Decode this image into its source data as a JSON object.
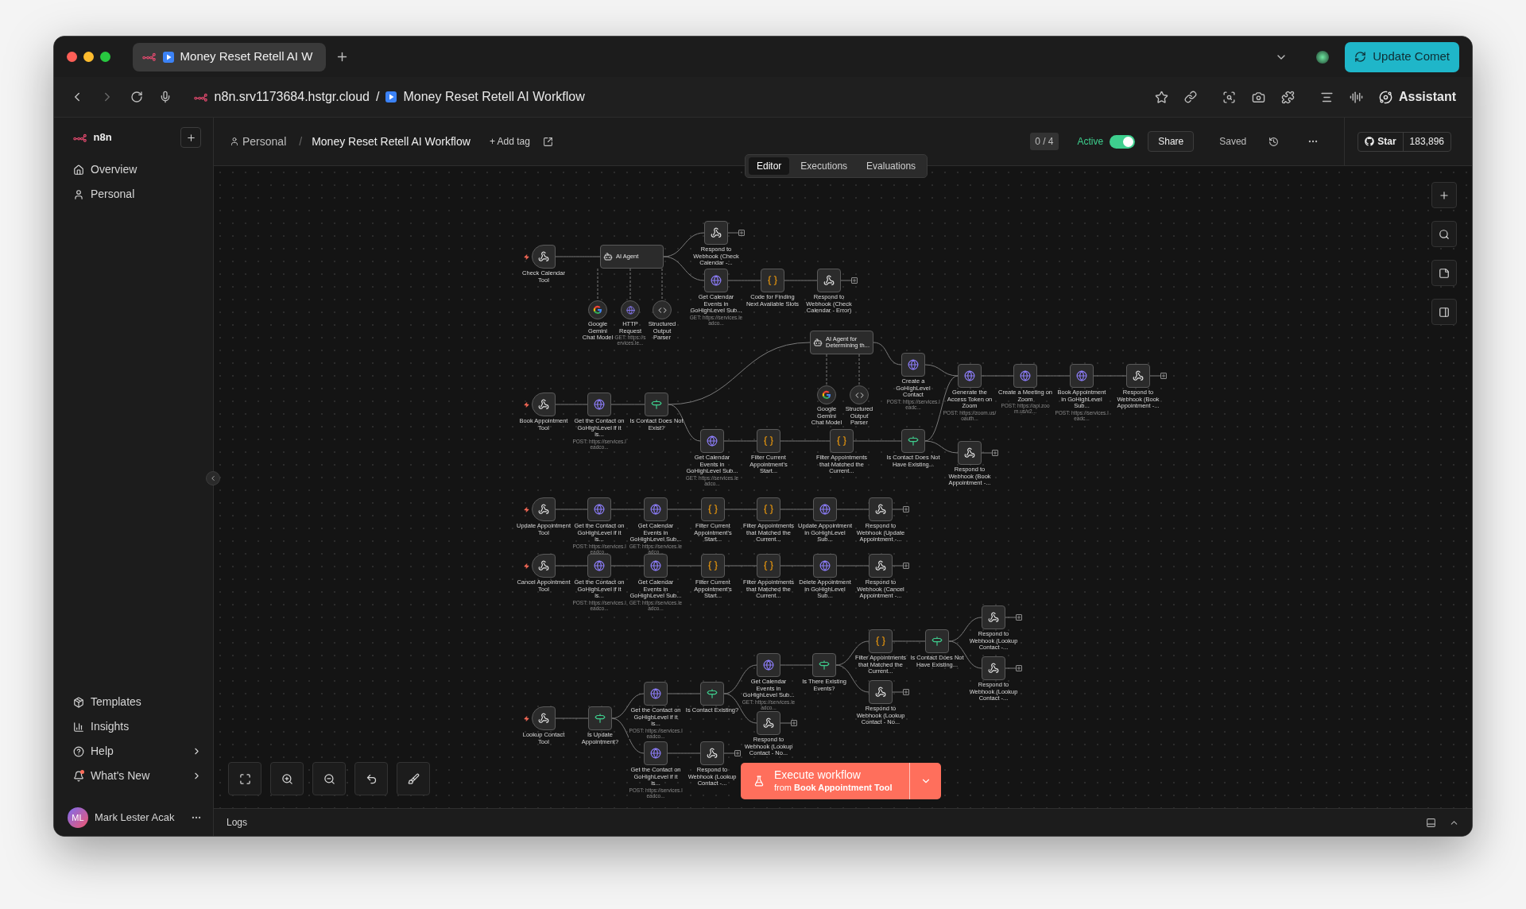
{
  "browser": {
    "tab_title": "Money Reset Retell AI W",
    "update_button": "Update Comet",
    "address": {
      "host": "n8n.srv1173684.hstgr.cloud",
      "separator": "/",
      "page": "Money Reset Retell AI Workflow"
    },
    "assistant": "Assistant"
  },
  "sidebar": {
    "brand": "n8n",
    "top_items": [
      {
        "kind": "home",
        "label": "Overview"
      },
      {
        "kind": "user",
        "label": "Personal"
      }
    ],
    "bottom_items": [
      {
        "kind": "templates",
        "label": "Templates",
        "submenu": false,
        "notification": false
      },
      {
        "kind": "insights",
        "label": "Insights",
        "submenu": false,
        "notification": false
      },
      {
        "kind": "help",
        "label": "Help",
        "submenu": true,
        "notification": false
      },
      {
        "kind": "news",
        "label": "What's New",
        "submenu": true,
        "notification": true
      }
    ],
    "user": {
      "initials": "ML",
      "name": "Mark Lester Acak"
    }
  },
  "header": {
    "project": "Personal",
    "separator": "/",
    "title": "Money Reset Retell AI Workflow",
    "add_tag": "+ Add tag",
    "counter": "0 / 4",
    "active": {
      "label": "Active",
      "on": true
    },
    "share": "Share",
    "status": "Saved",
    "star": {
      "label": "Star",
      "count": "183,896"
    }
  },
  "view_tabs": [
    {
      "label": "Editor",
      "selected": true
    },
    {
      "label": "Executions",
      "selected": false
    },
    {
      "label": "Evaluations",
      "selected": false
    }
  ],
  "workflows": [
    {
      "nodes": [
        {
          "kind": "trigger",
          "label": "Check Calendar Tool"
        },
        {
          "kind": "agent",
          "label": "AI Agent"
        },
        {
          "kind": "webhook",
          "label": "Respond to Webhook (Check Calendar -..."
        },
        {
          "kind": "http",
          "label": "Get Calendar Events in GoHighLevel Sub...",
          "subtitle": "GET: https://services.leadco..."
        },
        {
          "kind": "code",
          "label": "Code for Finding Next Available Slots"
        },
        {
          "kind": "webhook",
          "label": "Respond to Webhook (Check Calendar - Error)"
        },
        {
          "kind": "model",
          "label": "Google Gemini Chat Model"
        },
        {
          "kind": "tool",
          "label": "HTTP Request",
          "subtitle": "GET: https://services.le..."
        },
        {
          "kind": "parser",
          "label": "Structured Output Parser"
        }
      ]
    },
    {
      "nodes": [
        {
          "kind": "trigger",
          "label": "Book Appointment Tool"
        },
        {
          "kind": "http",
          "label": "Get the Contact on GoHighLevel if it is...",
          "subtitle": "POST: https://services.leadco..."
        },
        {
          "kind": "if",
          "label": "Is Contact Does Not Exist?"
        },
        {
          "kind": "agent",
          "label": "AI Agent for Determining th..."
        },
        {
          "kind": "model",
          "label": "Google Gemini Chat Model"
        },
        {
          "kind": "parser",
          "label": "Structured Output Parser"
        },
        {
          "kind": "http",
          "label": "Create a GoHighLevel Contact",
          "subtitle": "POST: https://services.leadc..."
        },
        {
          "kind": "http",
          "label": "Generate the Access Token on Zoom",
          "subtitle": "POST: https://zoom.us/oauth..."
        },
        {
          "kind": "http",
          "label": "Create a Meeting on Zoom",
          "subtitle": "POST: https://api.zoom.us/v2..."
        },
        {
          "kind": "http",
          "label": "Book Appointment in GoHighLevel Sub...",
          "subtitle": "POST: https://services.leadc..."
        },
        {
          "kind": "webhook",
          "label": "Respond to Webhook (Book Appointment -..."
        },
        {
          "kind": "http",
          "label": "Get Calendar Events in GoHighLevel Sub...",
          "subtitle": "GET: https://services.leadco..."
        },
        {
          "kind": "code",
          "label": "Filter Current Appointment's Start..."
        },
        {
          "kind": "code",
          "label": "Filter Appointments that Matched the Current..."
        },
        {
          "kind": "if",
          "label": "Is Contact Does Not Have Existing..."
        },
        {
          "kind": "webhook",
          "label": "Respond to Webhook (Book Appointment -..."
        }
      ]
    },
    {
      "nodes": [
        {
          "kind": "trigger",
          "label": "Update Appointment Tool"
        },
        {
          "kind": "http",
          "label": "Get the Contact on GoHighLevel if it is...",
          "subtitle": "POST: https://services.leadco..."
        },
        {
          "kind": "http",
          "label": "Get Calendar Events in GoHighLevel Sub...",
          "subtitle": "GET: https://services.leadco..."
        },
        {
          "kind": "code",
          "label": "Filter Current Appointment's Start..."
        },
        {
          "kind": "code",
          "label": "Filter Appointments that Matched the Current..."
        },
        {
          "kind": "http",
          "label": "Update Appointment in GoHighLevel Sub..."
        },
        {
          "kind": "webhook",
          "label": "Respond to Webhook (Update Appointment -..."
        }
      ]
    },
    {
      "nodes": [
        {
          "kind": "trigger",
          "label": "Cancel Appointment Tool"
        },
        {
          "kind": "http",
          "label": "Get the Contact on GoHighLevel if it is...",
          "subtitle": "POST: https://services.leadco..."
        },
        {
          "kind": "http",
          "label": "Get Calendar Events in GoHighLevel Sub...",
          "subtitle": "GET: https://services.leadco..."
        },
        {
          "kind": "code",
          "label": "Filter Current Appointment's Start..."
        },
        {
          "kind": "code",
          "label": "Filter Appointments that Matched the Current..."
        },
        {
          "kind": "http",
          "label": "Delete Appointment in GoHighLevel Sub..."
        },
        {
          "kind": "webhook",
          "label": "Respond to Webhook (Cancel Appointment -..."
        }
      ]
    },
    {
      "nodes": [
        {
          "kind": "trigger",
          "label": "Lookup Contact Tool"
        },
        {
          "kind": "if",
          "label": "Is Update Appointment?"
        },
        {
          "kind": "http",
          "label": "Get the Contact on GoHighLevel if it is...",
          "subtitle": "POST: https://services.leadco..."
        },
        {
          "kind": "http",
          "label": "Get the Contact on GoHighLevel if it is...",
          "subtitle": "POST: https://services.leadco..."
        },
        {
          "kind": "if",
          "label": "Is Contact Existing?"
        },
        {
          "kind": "webhook",
          "label": "Respond to Webhook (Lookup Contact -..."
        },
        {
          "kind": "http",
          "label": "Get Calendar Events in GoHighLevel Sub...",
          "subtitle": "GET: https://services.leadco..."
        },
        {
          "kind": "webhook",
          "label": "Respond to Webhook (Lookup Contact - No..."
        },
        {
          "kind": "if",
          "label": "Is There Existing Events?"
        },
        {
          "kind": "code",
          "label": "Filter Appointments that Matched the Current..."
        },
        {
          "kind": "webhook",
          "label": "Respond to Webhook (Lookup Contact - No..."
        },
        {
          "kind": "if",
          "label": "Is Contact Does Not Have Existing..."
        },
        {
          "kind": "webhook",
          "label": "Respond to Webhook (Lookup Contact -..."
        },
        {
          "kind": "webhook",
          "label": "Respond to Webhook (Lookup Contact -..."
        }
      ]
    }
  ],
  "execute": {
    "title": "Execute workflow",
    "subtitle": "from **Book Appointment Tool**"
  },
  "logs": {
    "label": "Logs"
  }
}
